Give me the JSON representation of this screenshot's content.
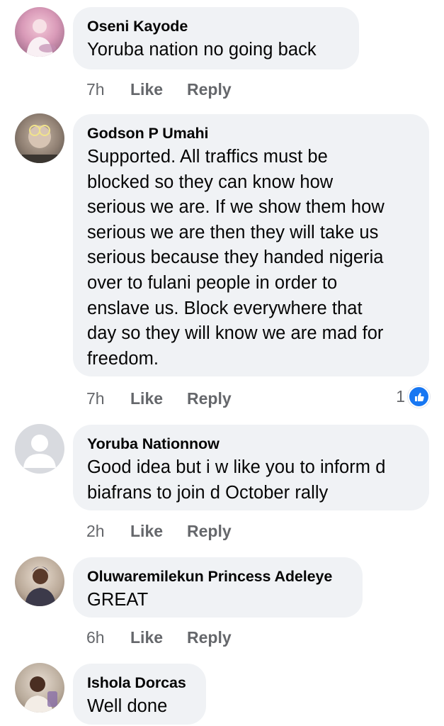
{
  "comments": [
    {
      "author": "Oseni Kayode",
      "text": "Yoruba nation no going back",
      "time": "7h",
      "like_label": "Like",
      "reply_label": "Reply"
    },
    {
      "author": "Godson P Umahi",
      "text": "Supported. All traffics must be\nblocked so they can know how\nserious we are. If we show them how\nserious we are then they will take us\nserious because they handed nigeria\nover to fulani people in order to\nenslave us. Block everywhere that\nday so they will know we are mad for\nfreedom.",
      "time": "7h",
      "like_label": "Like",
      "reply_label": "Reply",
      "reaction_count": "1"
    },
    {
      "author": "Yoruba Nationnow",
      "text": "Good idea but i w like you to inform d\nbiafrans to join d October rally",
      "time": "2h",
      "like_label": "Like",
      "reply_label": "Reply"
    },
    {
      "author": "Oluwaremilekun Princess Adeleye",
      "text": "GREAT",
      "time": "6h",
      "like_label": "Like",
      "reply_label": "Reply"
    },
    {
      "author": "Ishola Dorcas",
      "text": "Well done"
    }
  ],
  "colors": {
    "bubble": "#f0f2f5",
    "meta": "#65676b",
    "like_blue": "#1877f2"
  }
}
